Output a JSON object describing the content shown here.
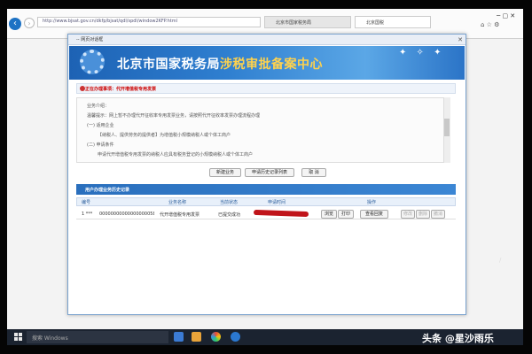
{
  "browser": {
    "url": "http://www.bjsat.gov.cn/dkfp/bjsat/qdl/spdl/window2KFP.html",
    "tabs": [
      {
        "label": "北京市国家税务局"
      },
      {
        "label": "北京国税"
      }
    ],
    "back_icon": "arrow-left",
    "forward_icon": "arrow-right"
  },
  "dialog": {
    "title": "-- 网页对话框",
    "close": "✕"
  },
  "banner": {
    "prefix": "北京市国家税务局",
    "highlight": "涉税审批备案中心"
  },
  "notice": {
    "heading": "正在办理事项：代开增值税专用发票",
    "lines": [
      "业务介绍：",
      "温馨提示：网上暂不办理代开征收率专用发票业务，请按照代开征收率发票办理流程办理",
      "(一) 适用企业",
      "【纳税人、提供劳务的提供者】为增值税小规模纳税人或个体工商户",
      "(二) 申请条件",
      "申请代开增值税专用发票的纳税人应具有税务登记的小规模纳税人或个体工商户"
    ]
  },
  "buttons": {
    "new": "新建业务",
    "history": "申请历史记录列表",
    "cancel": "取 消"
  },
  "records": {
    "heading": "用户办理业务历史记录",
    "columns": [
      "编号",
      "业务名称",
      "当前状态",
      "申请时间",
      "操作"
    ],
    "rows": [
      {
        "num": "1 ***",
        "code": "00000000000000000058589",
        "name": "代开增值税专用发票",
        "status": "已提交成功",
        "actions": [
          "浏览",
          "打印",
          "查看回复",
          "修改",
          "删除",
          "撤消"
        ]
      }
    ]
  },
  "taskbar": {
    "search_placeholder": "搜索 Windows"
  },
  "watermark": "头条 @星沙雨乐"
}
